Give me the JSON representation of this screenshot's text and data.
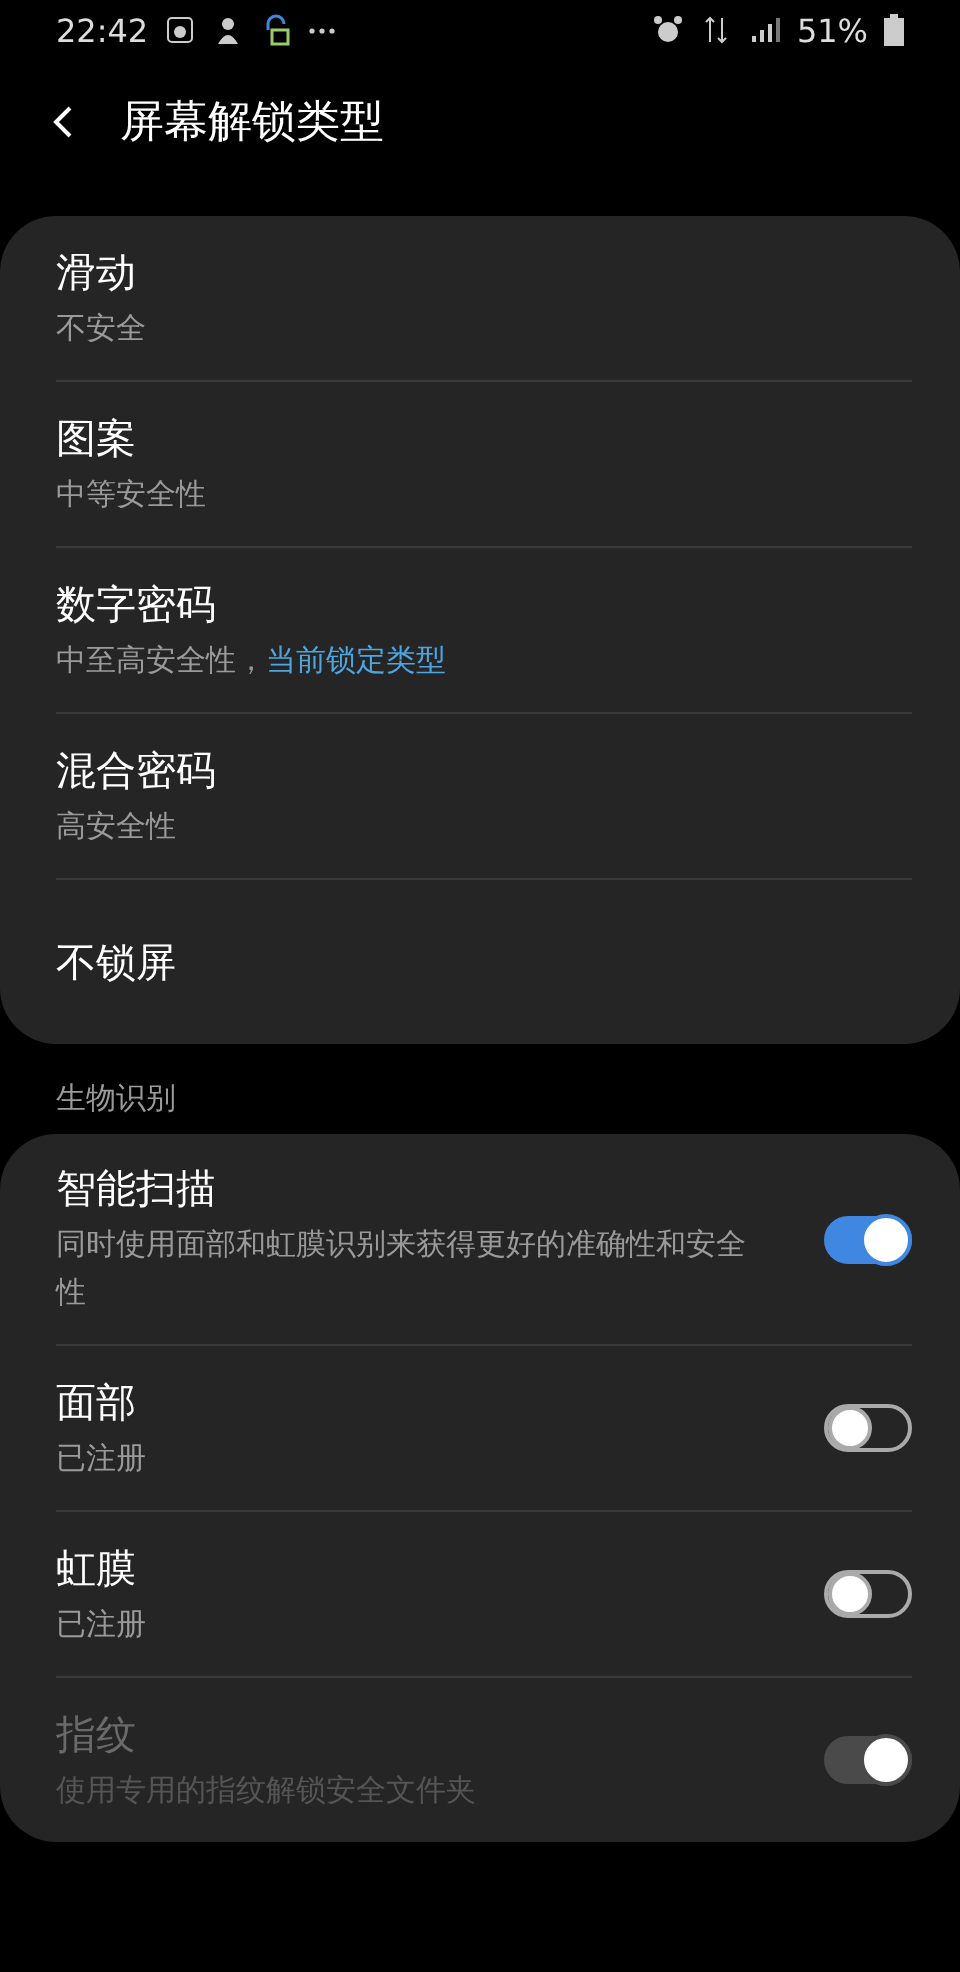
{
  "status_bar": {
    "time": "22:42",
    "battery": "51%"
  },
  "header": {
    "title": "屏幕解锁类型"
  },
  "lock_types": [
    {
      "title": "滑动",
      "subtitle": "不安全"
    },
    {
      "title": "图案",
      "subtitle": "中等安全性"
    },
    {
      "title": "数字密码",
      "subtitle": "中至高安全性，",
      "current": "当前锁定类型"
    },
    {
      "title": "混合密码",
      "subtitle": "高安全性"
    },
    {
      "title": "不锁屏"
    }
  ],
  "biometrics": {
    "header": "生物识别",
    "items": [
      {
        "title": "智能扫描",
        "subtitle": "同时使用面部和虹膜识别来获得更好的准确性和安全性",
        "on": true,
        "disabled": false
      },
      {
        "title": "面部",
        "subtitle": "已注册",
        "on": false,
        "disabled": false
      },
      {
        "title": "虹膜",
        "subtitle": "已注册",
        "on": false,
        "disabled": false
      },
      {
        "title": "指纹",
        "subtitle": "使用专用的指纹解锁安全文件夹",
        "on": true,
        "disabled": true
      }
    ]
  }
}
